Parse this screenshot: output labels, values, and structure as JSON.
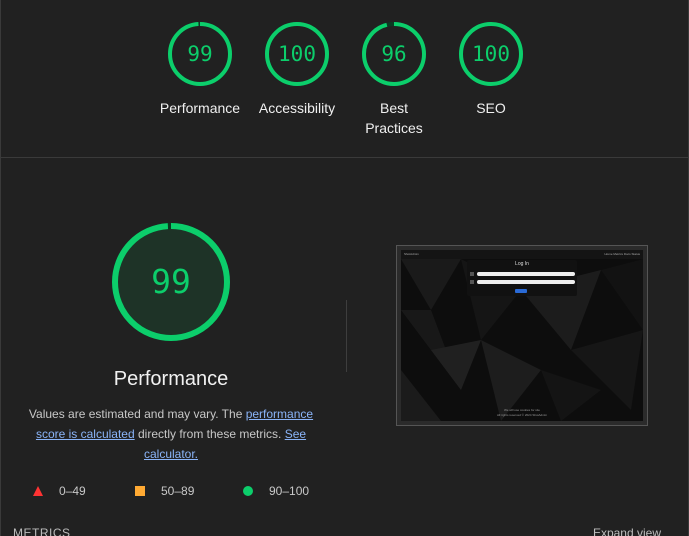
{
  "top_gauges": [
    {
      "label": "Performance",
      "value": "99",
      "score": 0.99
    },
    {
      "label": "Accessibility",
      "value": "100",
      "score": 1.0
    },
    {
      "label": "Best Practices",
      "value": "96",
      "score": 0.96
    },
    {
      "label": "SEO",
      "value": "100",
      "score": 1.0
    }
  ],
  "performance": {
    "value": "99",
    "score": 0.99,
    "title": "Performance",
    "desc_prefix": "Values are estimated and may vary. The ",
    "desc_link1": "performance score is calculated",
    "desc_middle": " directly from these metrics. ",
    "desc_link2": "See calculator."
  },
  "legend": [
    {
      "range": "0–49",
      "icon": "fail-triangle-icon"
    },
    {
      "range": "50–89",
      "icon": "average-square-icon"
    },
    {
      "range": "90–100",
      "icon": "pass-circle-icon"
    }
  ],
  "thumbnail": {
    "brand": "ShotAdmin",
    "nav_links": "Home  Metrics  Docs  Status",
    "login_title": "Log In",
    "footer_line1": "We will use cookies for site",
    "footer_line2": "All rights reserved © 2024 ShotAdmin"
  },
  "metrics": {
    "label": "METRICS",
    "expand": "Expand view"
  },
  "colors": {
    "pass": "#0cce6b",
    "average": "#ffaa33",
    "fail": "#ff3333",
    "background": "#212121"
  }
}
